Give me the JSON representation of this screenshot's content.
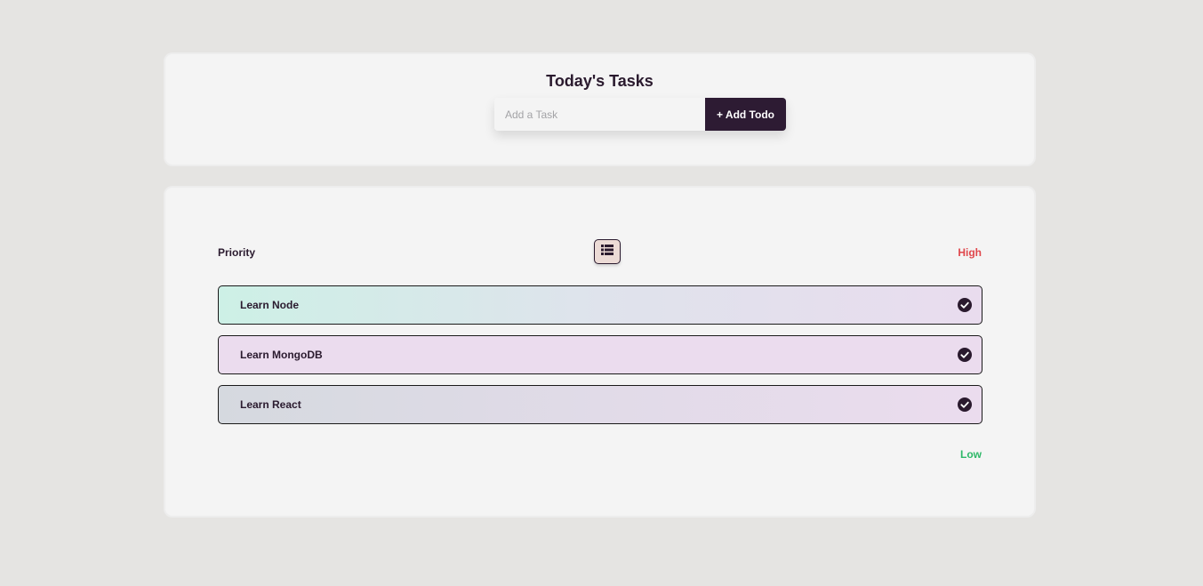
{
  "header": {
    "title": "Today's Tasks",
    "input_placeholder": "Add a Task",
    "input_value": "",
    "add_button_label": "+ Add Todo"
  },
  "list": {
    "priority_label": "Priority",
    "high_label": "High",
    "low_label": "Low",
    "sort_icon": "list-icon",
    "items": [
      {
        "label": "Learn Node",
        "status_icon": "check-circle-icon"
      },
      {
        "label": "Learn MongoDB",
        "status_icon": "check-circle-icon"
      },
      {
        "label": "Learn React",
        "status_icon": "check-circle-icon"
      }
    ]
  },
  "colors": {
    "high": "#e0474c",
    "low": "#2eb868",
    "accent": "#2d1b33",
    "background": "#e5e4e2",
    "card": "#f4f4f4"
  }
}
